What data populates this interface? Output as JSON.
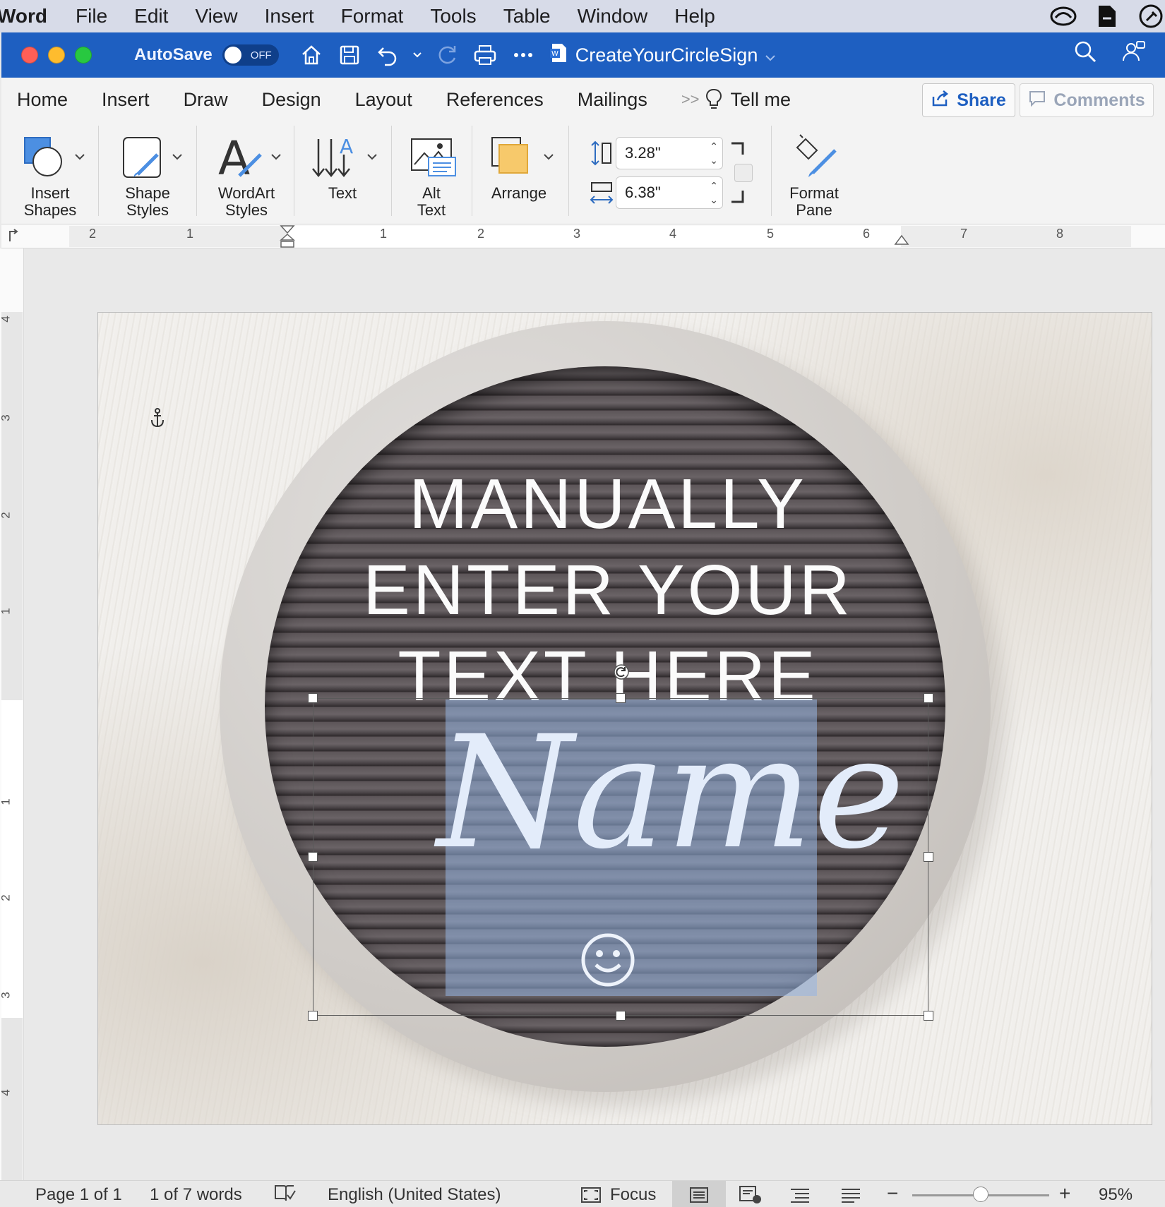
{
  "menubar": {
    "app_name": "Word",
    "items": [
      "File",
      "Edit",
      "View",
      "Insert",
      "Format",
      "Tools",
      "Table",
      "Window",
      "Help"
    ]
  },
  "titlebar": {
    "autosave_label": "AutoSave",
    "autosave_state": "OFF",
    "document_title": "CreateYourCircleSign"
  },
  "tabs": {
    "items": [
      "Home",
      "Insert",
      "Draw",
      "Design",
      "Layout",
      "References",
      "Mailings"
    ],
    "more": ">>",
    "tell_me": "Tell me",
    "share": "Share",
    "comments": "Comments"
  },
  "ribbon": {
    "insert_shapes": "Insert Shapes",
    "shape_styles": "Shape Styles",
    "wordart_styles": "WordArt Styles",
    "text": "Text",
    "alt_text": "Alt Text",
    "arrange": "Arrange",
    "height_value": "3.28\"",
    "width_value": "6.38\"",
    "format_pane": "Format Pane"
  },
  "ruler": {
    "horizontal": [
      "2",
      "1",
      "1",
      "2",
      "3",
      "4",
      "5",
      "6",
      "7",
      "8"
    ],
    "vertical": [
      "4",
      "3",
      "2",
      "1",
      "1",
      "2",
      "3",
      "4"
    ]
  },
  "document": {
    "line1": "MANUALLY",
    "line2": "ENTER YOUR",
    "line3": "TEXT HERE",
    "name_text": "Name"
  },
  "statusbar": {
    "page": "Page 1 of 1",
    "words": "1 of 7 words",
    "language": "English (United States)",
    "focus": "Focus",
    "zoom": "95%",
    "zoom_level": 0.5
  },
  "colors": {
    "titlebar": "#1e5fc1",
    "close": "#ff5f57",
    "minimize": "#febc2e",
    "maximize": "#28c840"
  }
}
